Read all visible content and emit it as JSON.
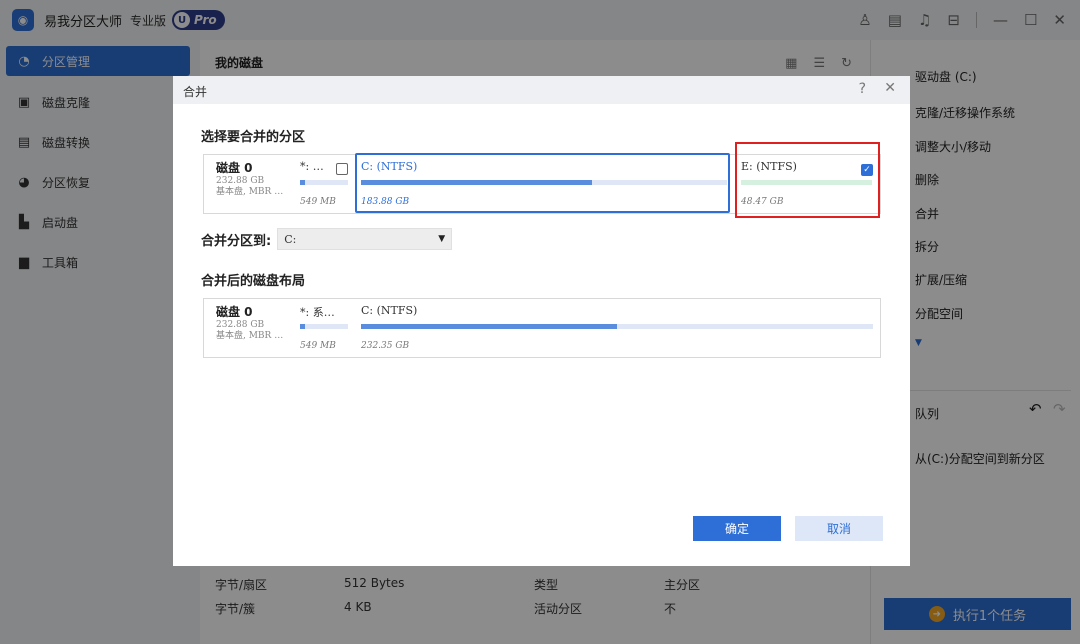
{
  "app": {
    "title": "易我分区大师",
    "edition": "专业版",
    "badge_letter": "U",
    "badge_text": "Pro"
  },
  "sidebar": {
    "items": [
      {
        "label": "分区管理",
        "icon": "pie-chart-icon",
        "active": true
      },
      {
        "label": "磁盘克隆",
        "icon": "disk-clone-icon",
        "active": false
      },
      {
        "label": "磁盘转换",
        "icon": "disk-convert-icon",
        "active": false
      },
      {
        "label": "分区恢复",
        "icon": "partition-recovery-icon",
        "active": false
      },
      {
        "label": "启动盘",
        "icon": "boot-disk-icon",
        "active": false
      },
      {
        "label": "工具箱",
        "icon": "toolbox-icon",
        "active": false
      }
    ]
  },
  "main": {
    "title": "我的磁盘",
    "props": {
      "bytes_per_sector_label": "字节/扇区",
      "bytes_per_sector_value": "512 Bytes",
      "bytes_per_cluster_label": "字节/簇",
      "bytes_per_cluster_value": "4 KB",
      "type_label": "类型",
      "type_value": "主分区",
      "active_label": "活动分区",
      "active_value": "不"
    }
  },
  "right_panel": {
    "drive_label": "驱动盘  (C:)",
    "ops": [
      "克隆/迁移操作系统",
      "调整大小/移动",
      "删除",
      "合并",
      "拆分",
      "扩展/压缩",
      "分配空间"
    ],
    "more_arrow": "▼",
    "queue_title": "队列",
    "queue_item": "从(C:)分配空间到新分区",
    "execute_label": "执行1个任务"
  },
  "dialog": {
    "title": "合并",
    "help": "?",
    "close": "✕",
    "select_title": "选择要合并的分区",
    "merge_to_label": "合并分区到:",
    "merge_to_value": "C:",
    "layout_title": "合并后的磁盘布局",
    "ok_label": "确定",
    "cancel_label": "取消",
    "select_disk": {
      "name": "磁盘 0",
      "size": "232.88 GB",
      "desc": "基本盘, MBR …",
      "partitions": [
        {
          "label": "*: …",
          "size": "549 MB",
          "fill": 0.1,
          "checked": false
        },
        {
          "label": "C: (NTFS)",
          "size": "183.88 GB",
          "fill": 0.63,
          "checked": true
        },
        {
          "label": "E: (NTFS)",
          "size": "48.47 GB",
          "fill": 0.0,
          "checked": true
        }
      ]
    },
    "result_disk": {
      "name": "磁盘 0",
      "size": "232.88 GB",
      "desc": "基本盘, MBR …",
      "partitions": [
        {
          "label": "*: 系…",
          "size": "549 MB",
          "fill": 0.1
        },
        {
          "label": "C: (NTFS)",
          "size": "232.35 GB",
          "fill": 0.5
        }
      ]
    }
  },
  "colors": {
    "accent": "#2d6fd6",
    "highlight_frame": "#e02020",
    "bar_fill": "#5b8ddf",
    "e_bar": "#d6f0df"
  }
}
